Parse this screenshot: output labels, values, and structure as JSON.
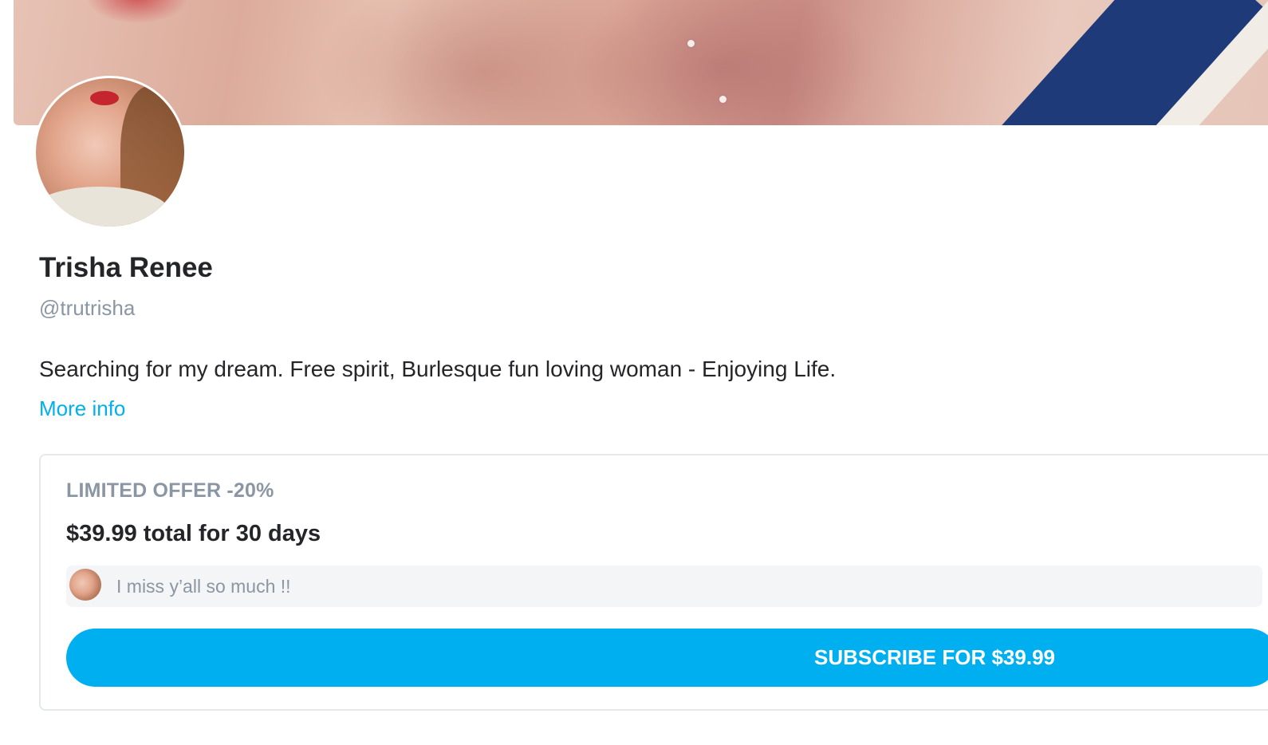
{
  "profile": {
    "name": "Trisha Renee",
    "handle": "@trutrisha",
    "bio": "Searching for my dream. Free spirit, Burlesque fun loving woman - Enjoying Life.",
    "more_info": "More info"
  },
  "subscription": {
    "offer_label": "LIMITED OFFER -20%",
    "price_text": "$39.99 total for 30 days",
    "message": "I miss y’all so much !!",
    "button_label": "SUBSCRIBE FOR $39.99"
  },
  "colors": {
    "accent": "#00aff0",
    "muted_text": "#8a96a3",
    "primary_text": "#242529"
  }
}
